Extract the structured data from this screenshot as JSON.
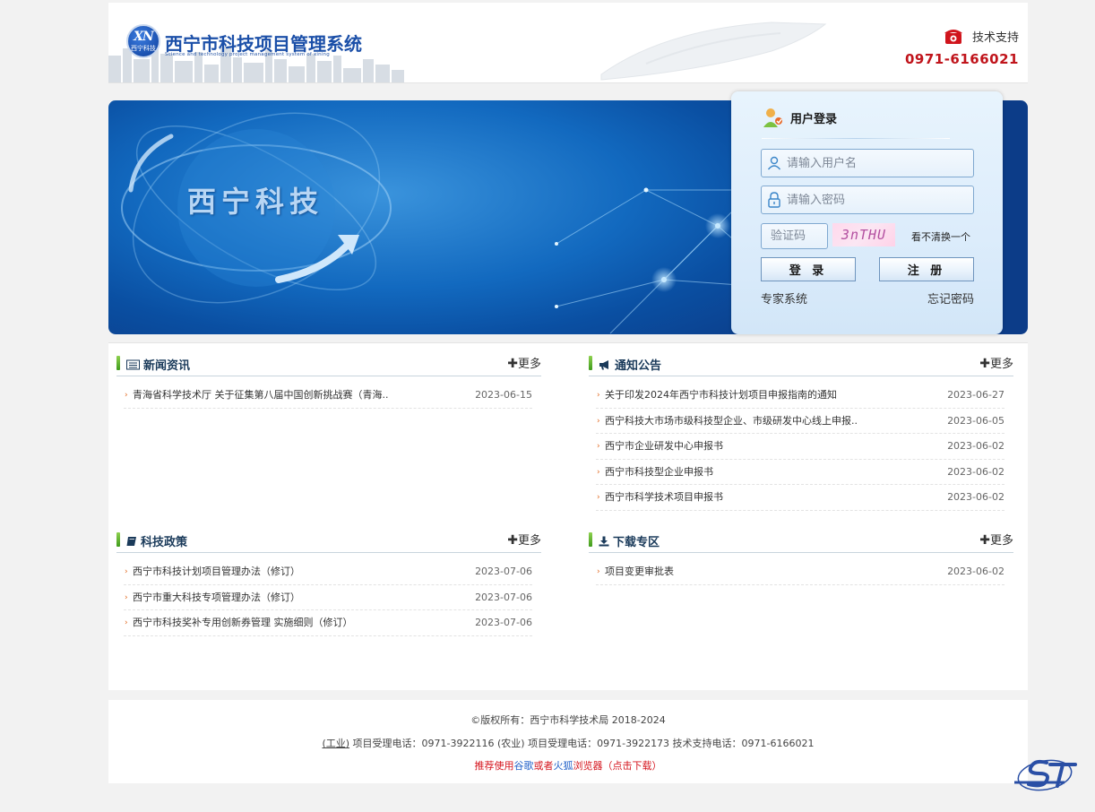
{
  "header": {
    "logo_badge_letters": "XN",
    "logo_badge_text": "西宁科技",
    "system_title": "西宁市科技项目管理系统",
    "system_subtitle": "Science and technology project management system of xining",
    "support_label": "技术支持",
    "support_phone": "0971-6166021"
  },
  "banner": {
    "text": "西宁科技"
  },
  "login": {
    "title": "用户登录",
    "username_placeholder": "请输入用户名",
    "password_placeholder": "请输入密码",
    "captcha_placeholder": "验证码",
    "captcha_text": "3nTHU",
    "captcha_refresh": "看不清换一个",
    "login_button": "登 录",
    "register_button": "注 册",
    "expert_link": "专家系统",
    "forgot_link": "忘记密码"
  },
  "panels": {
    "news": {
      "title": "新闻资讯",
      "more": "更多",
      "items": [
        {
          "title": "青海省科学技术厅 关于征集第八届中国创新挑战赛（青海..",
          "date": "2023-06-15"
        }
      ]
    },
    "notice": {
      "title": "通知公告",
      "more": "更多",
      "items": [
        {
          "title": "关于印发2024年西宁市科技计划项目申报指南的通知",
          "date": "2023-06-27"
        },
        {
          "title": "西宁科技大市场市级科技型企业、市级研发中心线上申报..",
          "date": "2023-06-05"
        },
        {
          "title": "西宁市企业研发中心申报书",
          "date": "2023-06-02"
        },
        {
          "title": "西宁市科技型企业申报书",
          "date": "2023-06-02"
        },
        {
          "title": "西宁市科学技术项目申报书",
          "date": "2023-06-02"
        }
      ]
    },
    "policy": {
      "title": "科技政策",
      "more": "更多",
      "items": [
        {
          "title": "西宁市科技计划项目管理办法（修订）",
          "date": "2023-07-06"
        },
        {
          "title": "西宁市重大科技专项管理办法（修订）",
          "date": "2023-07-06"
        },
        {
          "title": "西宁市科技奖补专用创新券管理 实施细则（修订）",
          "date": "2023-07-06"
        }
      ]
    },
    "download": {
      "title": "下载专区",
      "more": "更多",
      "items": [
        {
          "title": "项目变更审批表",
          "date": "2023-06-02"
        }
      ]
    }
  },
  "footer": {
    "copyright": "©版权所有：西宁市科学技术局 2018-2024",
    "industry_link": "(工业)",
    "industry_phone": " 项目受理电话：0971-3922116 ",
    "agri_link": "(农业)",
    "agri_phone": " 项目受理电话：0971-3922173 技术支持电话：0971-6166021",
    "browser_prefix": "推荐使用",
    "browser_chrome": "谷歌",
    "browser_or": "或者",
    "browser_firefox": "火狐",
    "browser_suffix": "浏览器（点击下载）"
  },
  "colors": {
    "brand_blue": "#1b4fa8",
    "phone_red": "#c0141b",
    "accent_green": "#3f9b1c",
    "arrow_orange": "#e2691f"
  }
}
